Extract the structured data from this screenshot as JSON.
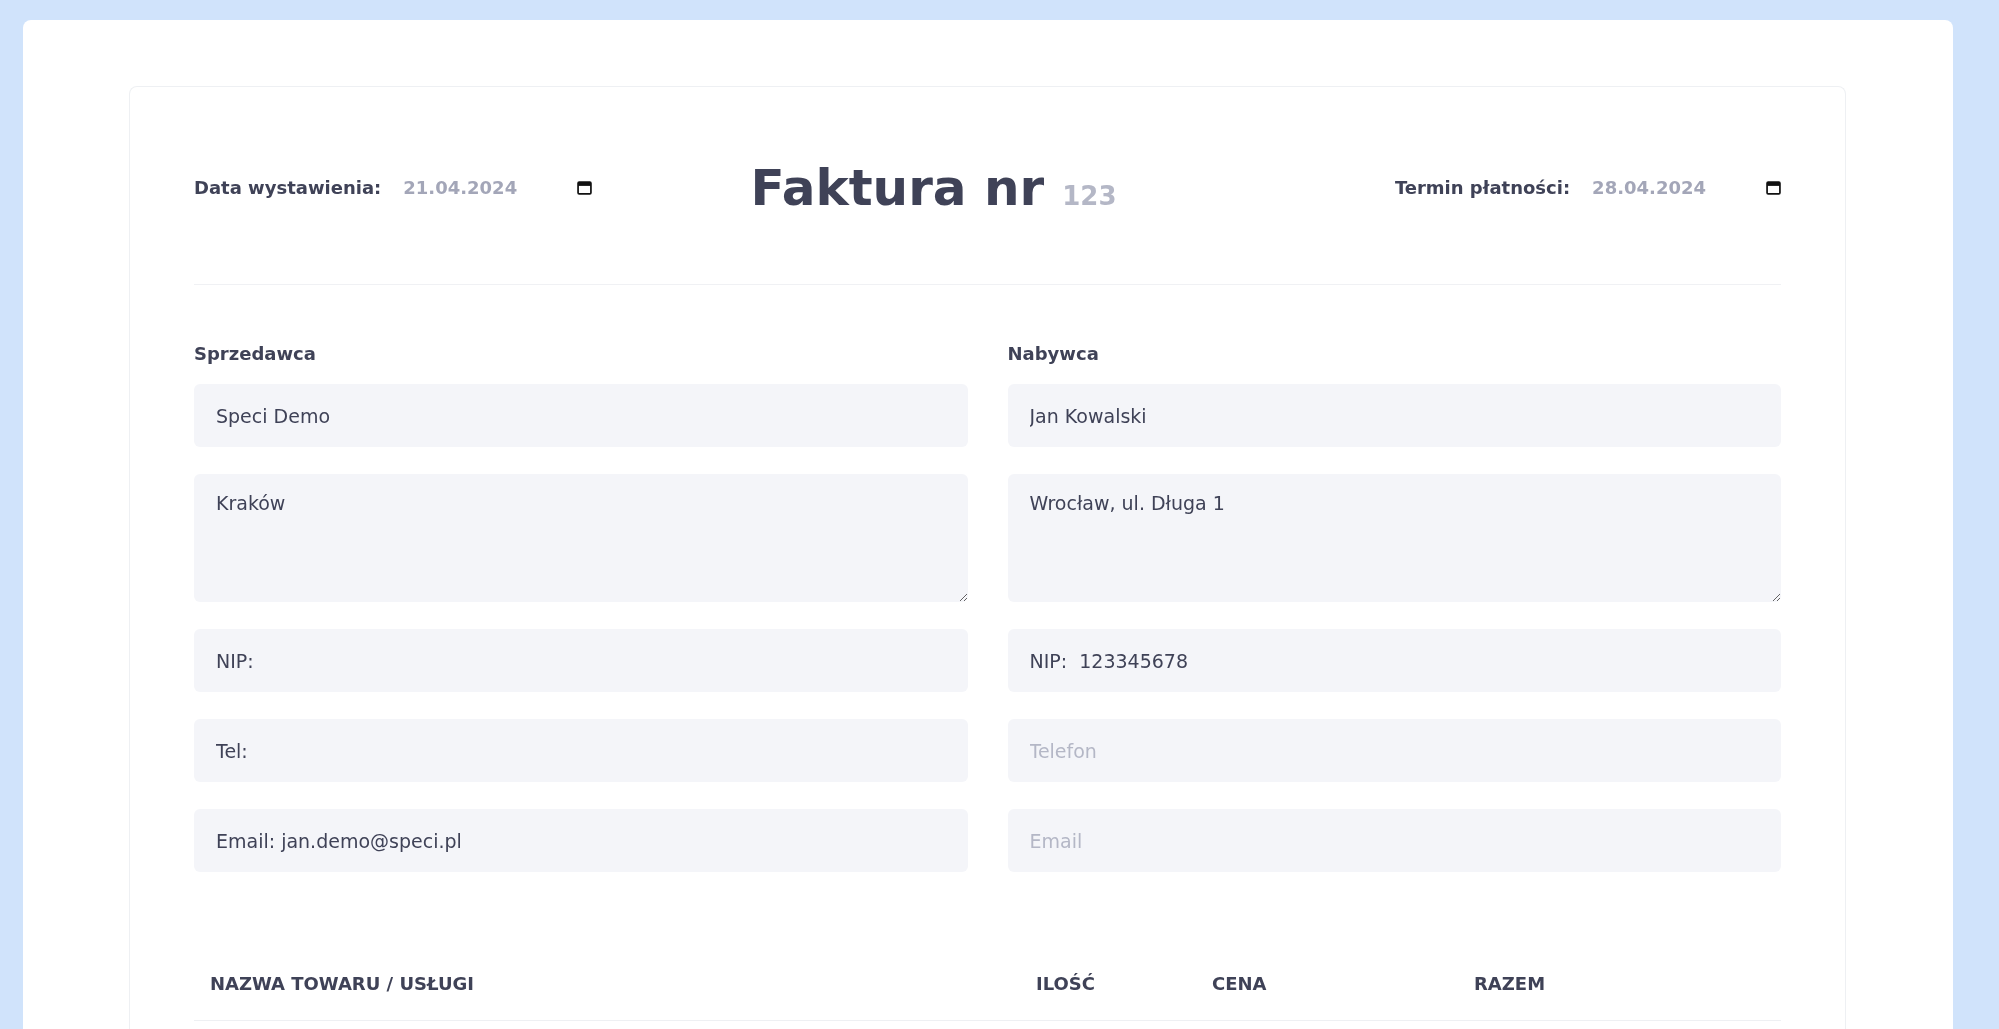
{
  "issue_date": {
    "label": "Data wystawienia:",
    "value": "21.04.2024"
  },
  "title": "Faktura nr",
  "invoice_number": "123",
  "due_date": {
    "label": "Termin płatności:",
    "value": "28.04.2024"
  },
  "parties": [
    {
      "heading": "Sprzedawca",
      "fields": [
        {
          "kind": "input",
          "value": "Speci Demo"
        },
        {
          "kind": "textarea",
          "value": "Kraków"
        },
        {
          "kind": "input",
          "value": "NIP:"
        },
        {
          "kind": "input",
          "value": "Tel:"
        },
        {
          "kind": "input",
          "value": "Email: jan.demo@speci.pl"
        }
      ]
    },
    {
      "heading": "Nabywca",
      "fields": [
        {
          "kind": "input",
          "value": "Jan Kowalski"
        },
        {
          "kind": "textarea",
          "value": "Wrocław, ul. Długa 1"
        },
        {
          "kind": "input",
          "value": "NIP:  123345678"
        },
        {
          "kind": "input",
          "placeholder": "Telefon"
        },
        {
          "kind": "input",
          "placeholder": "Email"
        }
      ]
    }
  ],
  "table": {
    "columns": [
      "NAZWA TOWARU / USŁUGI",
      "ILOŚĆ",
      "CENA",
      "RAZEM"
    ]
  }
}
